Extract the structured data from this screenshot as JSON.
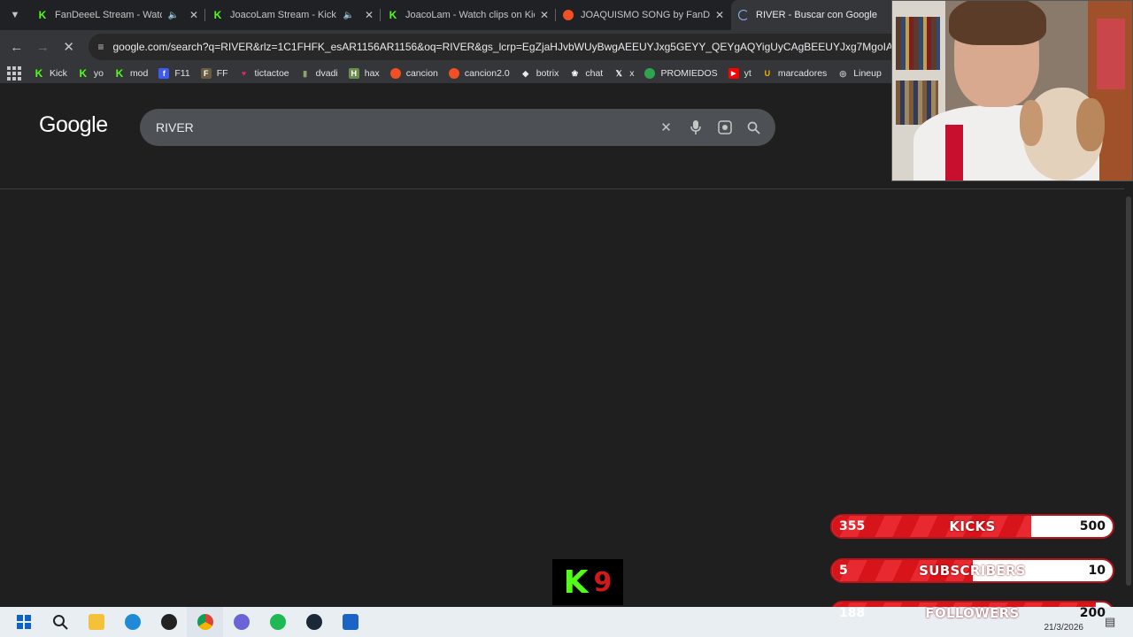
{
  "tabs": [
    {
      "title": "FanDeeeL Stream - Watch Live on Kick",
      "favicon": "kick-icon",
      "audio": true,
      "active": false
    },
    {
      "title": "JoacoLam Stream - Kick Da...",
      "favicon": "kick-icon",
      "audio": true,
      "active": false
    },
    {
      "title": "JoacoLam - Watch clips on Kick",
      "favicon": "kick-icon",
      "audio": false,
      "active": false
    },
    {
      "title": "JOAQUISMO SONG by FanDeeeL",
      "favicon": "music-icon",
      "audio": false,
      "active": false
    },
    {
      "title": "RIVER - Buscar con Google",
      "favicon": "loading-icon",
      "audio": false,
      "active": true
    }
  ],
  "toolbar": {
    "url": "google.com/search?q=RIVER&rlz=1C1FHFK_esAR1156AR1156&oq=RIVER&gs_lcrp=EgZjaHJvbWUyBwgAEEUYJxg5GEYY_QEYgAQYigUyCAgBEEUYJxg7MgoIAhAuGLEDGIAE"
  },
  "bookmarks": [
    {
      "label": "Kick",
      "icon": "kick-icon",
      "color": "#53fc18"
    },
    {
      "label": "yo",
      "icon": "kick-icon",
      "color": "#53fc18"
    },
    {
      "label": "mod",
      "icon": "kick-icon",
      "color": "#53fc18"
    },
    {
      "label": "F11",
      "icon": "f11-icon",
      "color": "#3d5af1"
    },
    {
      "label": "FF",
      "icon": "ff-icon",
      "color": "#6b5b3e"
    },
    {
      "label": "tictactoe",
      "icon": "heart-icon",
      "color": "#e0245e"
    },
    {
      "label": "dvadi",
      "icon": "bottle-icon",
      "color": "#8aa36b"
    },
    {
      "label": "hax",
      "icon": "hax-icon",
      "color": "#6b8e4e"
    },
    {
      "label": "cancion",
      "icon": "music-icon",
      "color": "#f25022"
    },
    {
      "label": "cancion2.0",
      "icon": "music-icon",
      "color": "#f25022"
    },
    {
      "label": "botrix",
      "icon": "diamond-icon",
      "color": "#1e88e5"
    },
    {
      "label": "chat",
      "icon": "openai-icon",
      "color": "#ffffff"
    },
    {
      "label": "x",
      "icon": "x-icon",
      "color": "#ffffff"
    },
    {
      "label": "PROMIEDOS",
      "icon": "ball-icon",
      "color": "#2ea44f"
    },
    {
      "label": "yt",
      "icon": "youtube-icon",
      "color": "#ff0000"
    },
    {
      "label": "marcadores",
      "icon": "u-icon",
      "color": "#f5b400"
    },
    {
      "label": "Lineup",
      "icon": "globe-icon",
      "color": "#c4c7c5"
    }
  ],
  "google": {
    "logo": "Google",
    "query": "RIVER"
  },
  "overlay": {
    "kick_logo_k": "K",
    "kick_logo_digit": "9",
    "goals": [
      {
        "current": "355",
        "label": "KICKS",
        "target": "500",
        "progress": 0.71
      },
      {
        "current": "5",
        "label": "SUBSCRIBERS",
        "target": "10",
        "progress": 0.5
      },
      {
        "current": "188",
        "label": "FOLLOWERS",
        "target": "200",
        "progress": 0.94
      }
    ]
  },
  "taskbar": {
    "apps": [
      "windows-start-icon",
      "search-icon",
      "file-explorer-icon",
      "edge-icon",
      "obs-icon",
      "chrome-icon",
      "chrome-profile-icon",
      "spotify-icon",
      "steam-icon",
      "app-icon"
    ],
    "date": "21/3/2026"
  },
  "colors": {
    "accent_red": "#d8141b",
    "kick_green": "#53fc18",
    "page_bg": "#1f1f1f"
  }
}
